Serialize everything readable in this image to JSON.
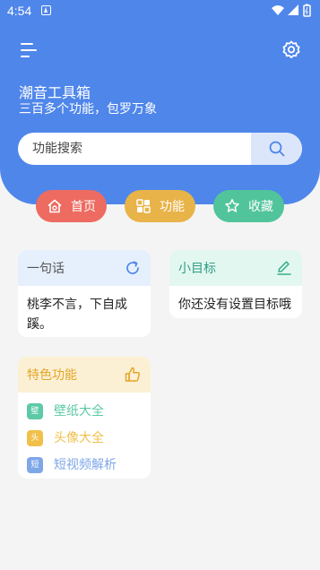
{
  "status_bar": {
    "time": "4:54"
  },
  "header": {
    "title": "潮音工具箱",
    "subtitle": "三百多个功能，包罗万象"
  },
  "search": {
    "placeholder": "功能搜索",
    "value": ""
  },
  "nav": [
    {
      "label": "首页",
      "icon": "home-icon",
      "color": "#ed6b60"
    },
    {
      "label": "功能",
      "icon": "grid-icon",
      "color": "#e8b348"
    },
    {
      "label": "收藏",
      "icon": "star-icon",
      "color": "#51c49c"
    }
  ],
  "sentence_card": {
    "title": "一句话",
    "text": "桃李不言，下自成蹊。",
    "action_icon": "refresh-icon"
  },
  "goal_card": {
    "title": "小目标",
    "text": "你还没有设置目标哦",
    "action_icon": "edit-icon"
  },
  "special_card": {
    "title": "特色功能",
    "action_icon": "thumbs-up-icon",
    "items": [
      {
        "badge": "壁",
        "label": "壁纸大全",
        "color": "#5cc9a7"
      },
      {
        "badge": "头",
        "label": "头像大全",
        "color": "#f0c04a"
      },
      {
        "badge": "短",
        "label": "短视频解析",
        "color": "#7ea7e8"
      }
    ]
  },
  "colors": {
    "primary": "#4f86ea",
    "background": "#f4f4f4"
  }
}
